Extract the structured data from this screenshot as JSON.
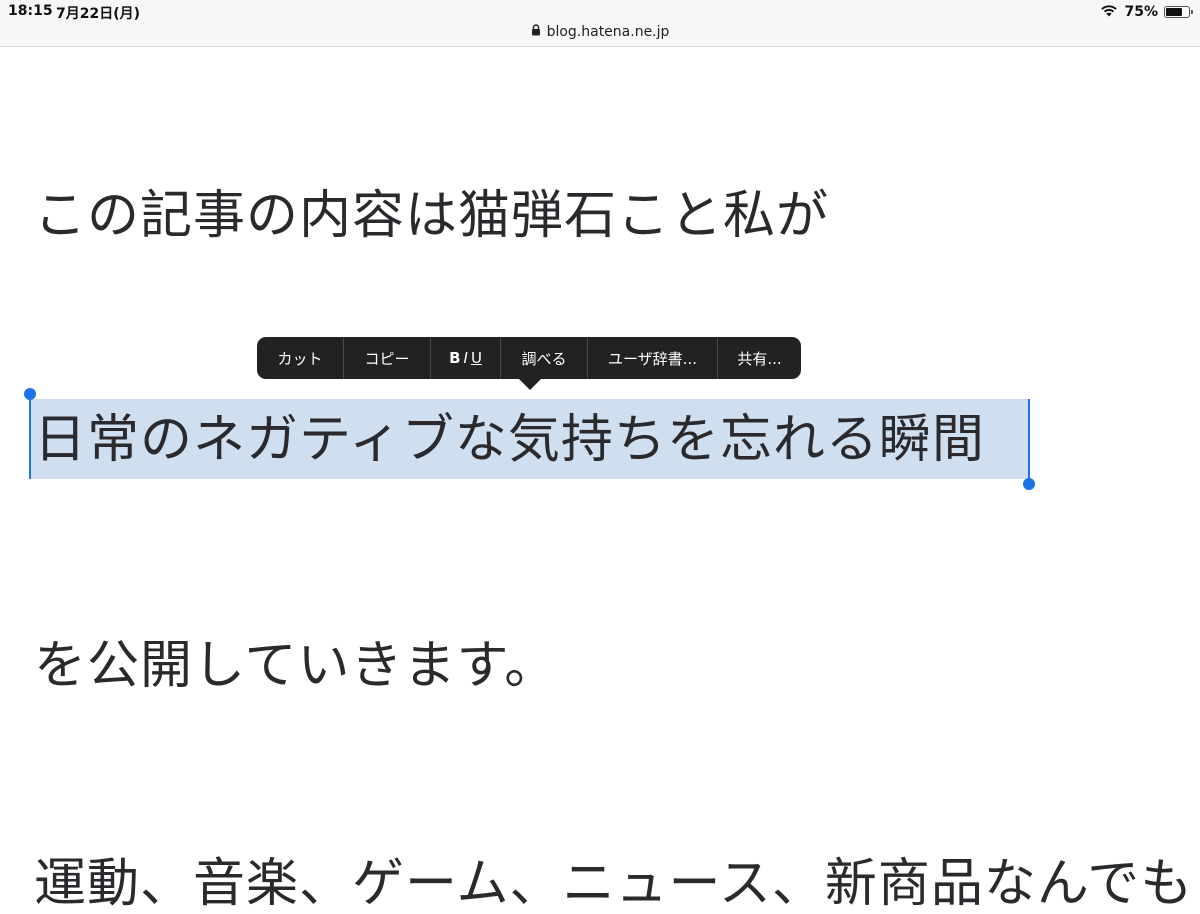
{
  "status": {
    "time": "18:15",
    "date": "7月22日(月)",
    "battery": "75%",
    "battery_level": 0.75
  },
  "browser": {
    "url": "blog.hatena.ne.jp"
  },
  "article": {
    "line1": "この記事の内容は猫弾石こと私が",
    "line2": "日常のネガティブな気持ちを忘れる瞬間",
    "line3": "を公開していきます。",
    "line4": "運動、音楽、ゲーム、ニュース、新商品なんでも"
  },
  "context_menu": {
    "cut": "カット",
    "copy": "コピー",
    "format_b": "B",
    "format_i": "I",
    "format_u": "U",
    "lookup": "調べる",
    "user_dict": "ユーザ辞書...",
    "share": "共有..."
  },
  "colors": {
    "selection": "#cfdfef",
    "handle": "#1a73e8",
    "menu": "#222224"
  }
}
